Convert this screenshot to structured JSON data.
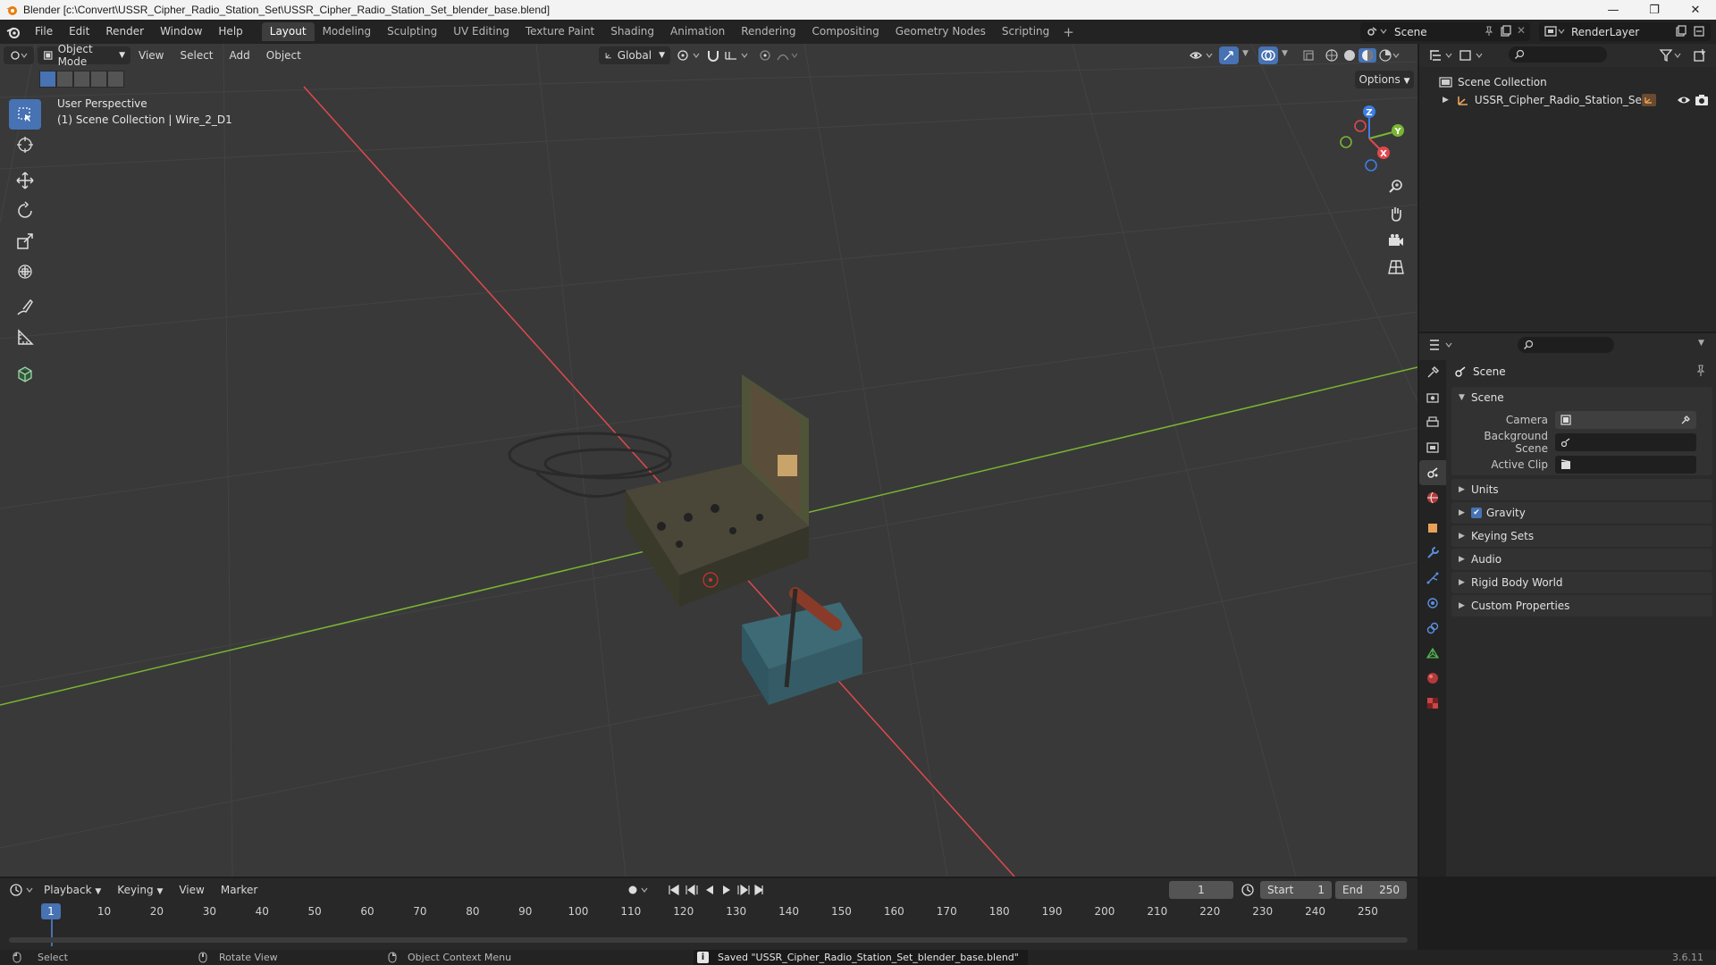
{
  "window": {
    "title": "Blender [c:\\Convert\\USSR_Cipher_Radio_Station_Set\\USSR_Cipher_Radio_Station_Set_blender_base.blend]",
    "controls": [
      "—",
      "❐",
      "✕"
    ]
  },
  "menu": {
    "items": [
      "File",
      "Edit",
      "Render",
      "Window",
      "Help"
    ]
  },
  "workspaces": {
    "tabs": [
      "Layout",
      "Modeling",
      "Sculpting",
      "UV Editing",
      "Texture Paint",
      "Shading",
      "Animation",
      "Rendering",
      "Compositing",
      "Geometry Nodes",
      "Scripting"
    ],
    "active": "Layout",
    "add": "+"
  },
  "scene_selector": {
    "value": "Scene"
  },
  "renderlayer_selector": {
    "value": "RenderLayer"
  },
  "viewport": {
    "mode": "Object Mode",
    "menus": [
      "View",
      "Select",
      "Add",
      "Object"
    ],
    "transform_orientation": "Global",
    "options_label": "Options",
    "perspective_label": "User Perspective",
    "collection_label": "(1) Scene Collection | Wire_2_D1",
    "gizmo_axes": {
      "x": "X",
      "y": "Y",
      "z": "Z"
    }
  },
  "outliner": {
    "root": "Scene Collection",
    "object": "USSR_Cipher_Radio_Station_Set"
  },
  "properties": {
    "context_title": "Scene",
    "scene_panel": {
      "title": "Scene",
      "camera_label": "Camera",
      "background_scene_label": "Background Scene",
      "active_clip_label": "Active Clip"
    },
    "collapsed_panels": [
      "Units",
      "Gravity",
      "Keying Sets",
      "Audio",
      "Rigid Body World",
      "Custom Properties"
    ],
    "gravity_checked": true
  },
  "timeline": {
    "menus": [
      "Playback",
      "Keying",
      "View",
      "Marker"
    ],
    "current_frame": "1",
    "start_label": "Start",
    "start_value": "1",
    "end_label": "End",
    "end_value": "250",
    "ticks": [
      "10",
      "20",
      "30",
      "40",
      "50",
      "60",
      "70",
      "80",
      "90",
      "100",
      "110",
      "120",
      "130",
      "140",
      "150",
      "160",
      "170",
      "180",
      "190",
      "200",
      "210",
      "220",
      "230",
      "240",
      "250"
    ]
  },
  "statusbar": {
    "select": "Select",
    "rotate": "Rotate View",
    "context_menu": "Object Context Menu",
    "message": "Saved \"USSR_Cipher_Radio_Station_Set_blender_base.blend\"",
    "version": "3.6.11"
  },
  "colors": {
    "accent": "#4772b3",
    "x_axis": "#e0484d",
    "y_axis": "#7ab531",
    "z_axis": "#3d7ee6"
  }
}
